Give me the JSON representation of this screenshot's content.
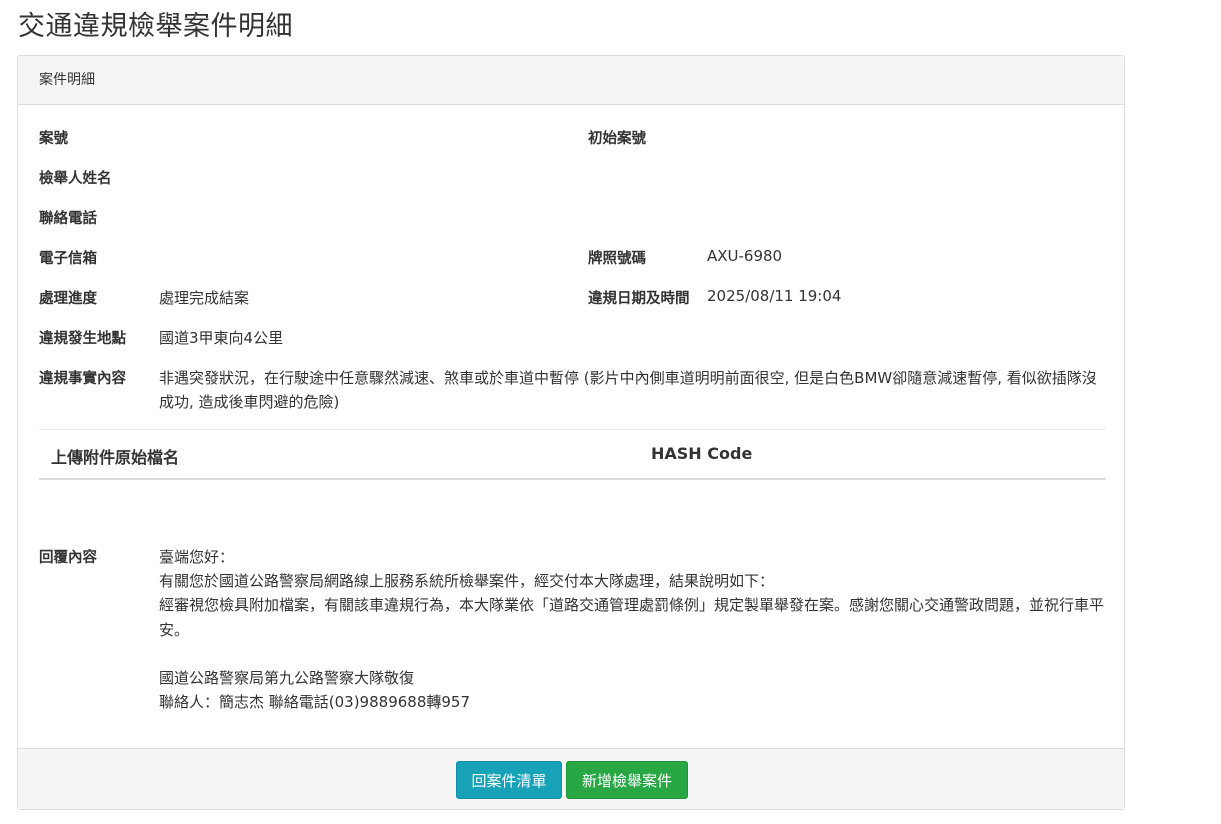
{
  "page": {
    "title": "交通違規檢舉案件明細"
  },
  "panel": {
    "heading": "案件明細"
  },
  "fields": {
    "case_no": {
      "label": "案號",
      "value": ""
    },
    "original_case_no": {
      "label": "初始案號",
      "value": ""
    },
    "reporter_name": {
      "label": "檢舉人姓名",
      "value": ""
    },
    "phone": {
      "label": "聯絡電話",
      "value": ""
    },
    "email": {
      "label": "電子信箱",
      "value": ""
    },
    "plate": {
      "label": "牌照號碼",
      "value": "AXU-6980"
    },
    "progress": {
      "label": "處理進度",
      "value": "處理完成結案"
    },
    "violation_datetime": {
      "label": "違規日期及時間",
      "value": "2025/08/11 19:04"
    },
    "location": {
      "label": "違規發生地點",
      "value": "國道3甲東向4公里"
    },
    "facts": {
      "label": "違規事實內容",
      "value": "非遇突發狀況，在行駛途中任意驟然減速、煞車或於車道中暫停 (影片中內側車道明明前面很空, 但是白色BMW卻隨意減速暫停, 看似欲插隊沒成功, 造成後車閃避的危險)"
    }
  },
  "attachments": {
    "col_filename": "上傳附件原始檔名",
    "col_hash": "HASH Code"
  },
  "reply": {
    "label": "回覆內容",
    "lines": [
      "臺端您好：",
      "有關您於國道公路警察局網路線上服務系統所檢舉案件，經交付本大隊處理，結果說明如下：",
      "經審視您檢具附加檔案，有關該車違規行為，本大隊業依「道路交通管理處罰條例」規定製單舉發在案。感謝您關心交通警政問題，並祝行車平安。",
      "",
      "國道公路警察局第九公路警察大隊敬復",
      "聯絡人：簡志杰 聯絡電話(03)9889688轉957"
    ]
  },
  "footer": {
    "back_button": "回案件清單",
    "new_button": "新增檢舉案件"
  },
  "colors": {
    "info": "#17a2b8",
    "success": "#28a745",
    "panel_bg": "#f5f5f5",
    "border": "#dddddd"
  }
}
